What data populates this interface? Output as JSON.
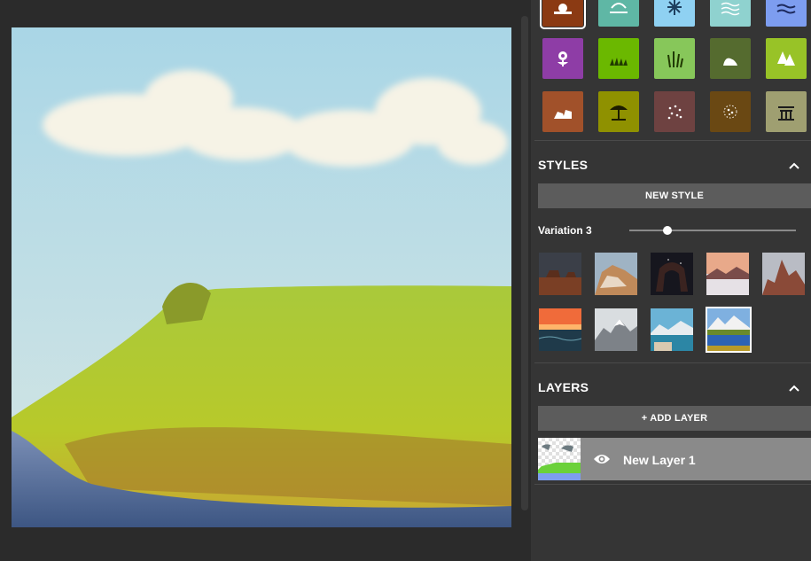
{
  "canvas": {
    "image": "landscape-painting"
  },
  "palette": {
    "tiles": [
      {
        "name": "sunset-icon",
        "color": "#8b3a13",
        "selected": true
      },
      {
        "name": "fog-icon",
        "color": "#5fb7a5"
      },
      {
        "name": "snowflake-icon",
        "color": "#8fd1f2"
      },
      {
        "name": "water-waves-icon",
        "color": "#8fd2cf"
      },
      {
        "name": "sea-icon",
        "color": "#7d9df0"
      },
      {
        "name": "flower-icon",
        "color": "#8e3da6"
      },
      {
        "name": "grass-icon",
        "color": "#6bb800"
      },
      {
        "name": "tall-grass-icon",
        "color": "#87c75a"
      },
      {
        "name": "hill-icon",
        "color": "#556b2f"
      },
      {
        "name": "trees-icon",
        "color": "#98c327"
      },
      {
        "name": "rocks-icon",
        "color": "#a1512a"
      },
      {
        "name": "beach-umbrella-icon",
        "color": "#8f9100"
      },
      {
        "name": "gravel-icon",
        "color": "#6e4241"
      },
      {
        "name": "dirt-icon",
        "color": "#6a4813"
      },
      {
        "name": "bridge-icon",
        "color": "#9f9f71"
      }
    ]
  },
  "styles": {
    "title": "STYLES",
    "new_style_label": "NEW STYLE",
    "variation_label": "Variation 3",
    "slider_value": 0.23,
    "thumbnails": [
      {
        "name": "style-desert-mesa",
        "selected": false
      },
      {
        "name": "style-desert-rocks",
        "selected": false
      },
      {
        "name": "style-night-arch",
        "selected": false
      },
      {
        "name": "style-misty-sunset",
        "selected": false
      },
      {
        "name": "style-red-peaks",
        "selected": false
      },
      {
        "name": "style-ocean-sunset",
        "selected": false
      },
      {
        "name": "style-snowy-mountain",
        "selected": false
      },
      {
        "name": "style-lake-shore",
        "selected": false
      },
      {
        "name": "style-mountain-lake",
        "selected": true
      }
    ]
  },
  "layers": {
    "title": "LAYERS",
    "add_layer_label": "+ ADD LAYER",
    "items": [
      {
        "name": "New Layer 1",
        "visible": true
      }
    ]
  }
}
